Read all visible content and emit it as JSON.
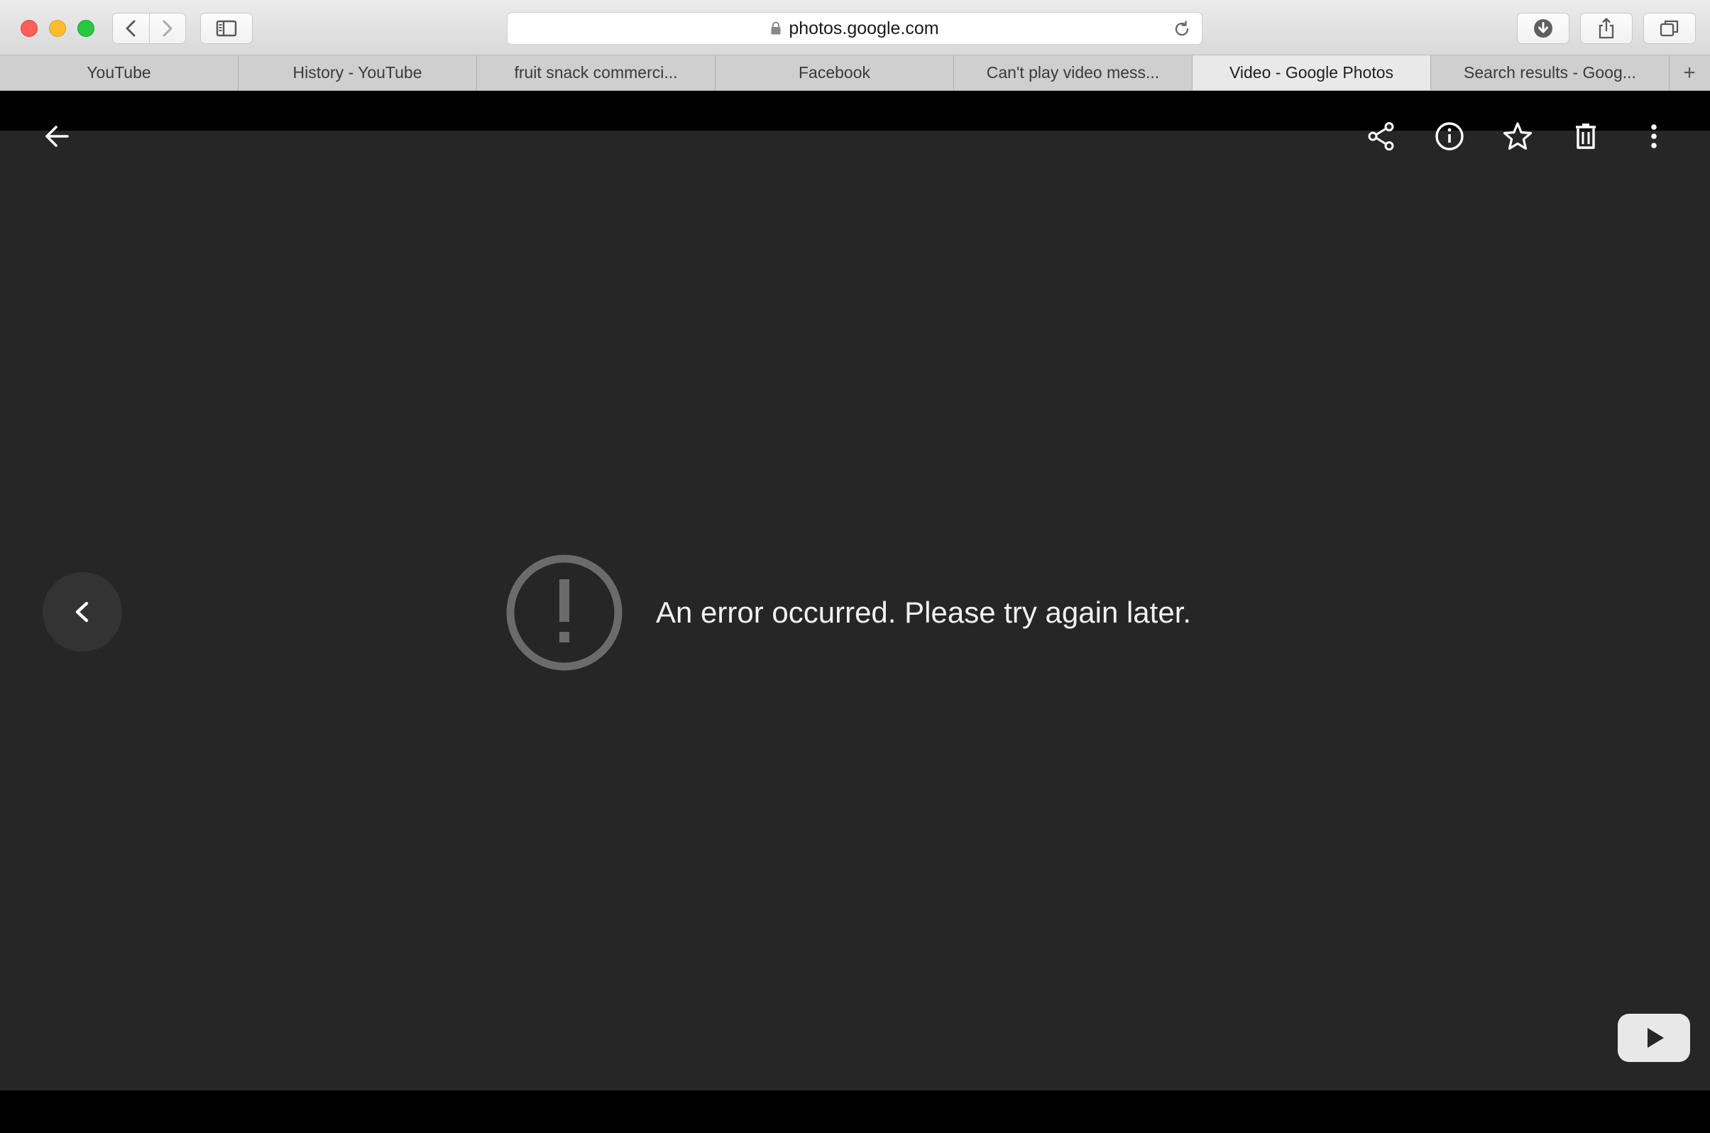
{
  "browser": {
    "url": "photos.google.com",
    "tabs": [
      {
        "label": "YouTube",
        "active": false
      },
      {
        "label": "History - YouTube",
        "active": false
      },
      {
        "label": "fruit snack commerci...",
        "active": false
      },
      {
        "label": "Facebook",
        "active": false
      },
      {
        "label": "Can't play video mess...",
        "active": false
      },
      {
        "label": "Video - Google Photos",
        "active": true
      },
      {
        "label": "Search results - Goog...",
        "active": false
      }
    ],
    "new_tab_label": "+"
  },
  "viewer": {
    "error_message": "An error occurred. Please try again later.",
    "toolbar_icons": [
      "back-arrow-icon",
      "share-icon",
      "info-icon",
      "star-icon",
      "trash-icon",
      "more-vert-icon"
    ],
    "colors": {
      "background": "#262626",
      "bars": "#000000",
      "error_icon": "#6b6b6b",
      "text": "#f1f1f1"
    }
  }
}
